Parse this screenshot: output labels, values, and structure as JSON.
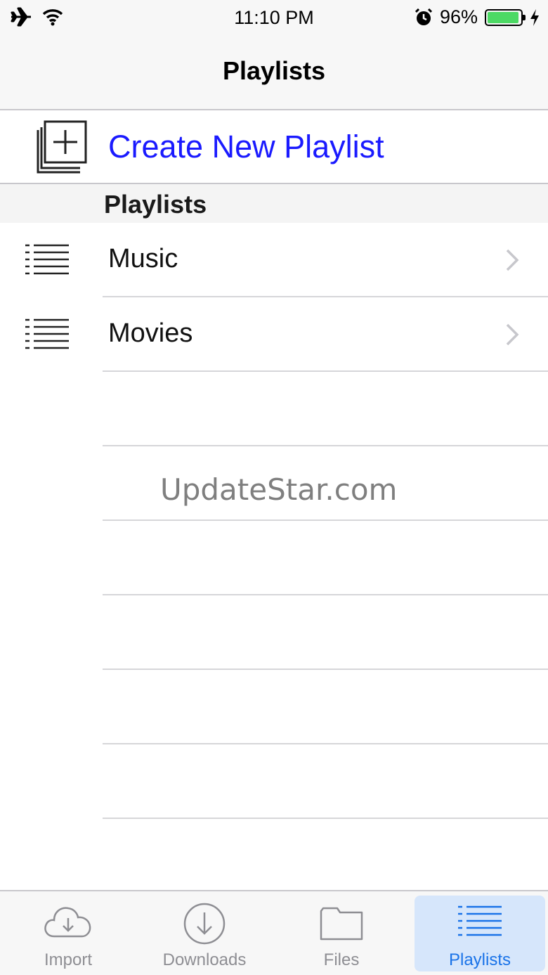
{
  "status_bar": {
    "time": "11:10 PM",
    "battery_percent": "96%",
    "battery_level": 0.96,
    "icons": [
      "airplane-icon",
      "wifi-icon",
      "alarm-icon",
      "battery-icon",
      "charging-bolt-icon"
    ]
  },
  "nav": {
    "title": "Playlists"
  },
  "create": {
    "label": "Create New Playlist",
    "icon": "add-playlist-icon",
    "color": "#1a1aff"
  },
  "section": {
    "title": "Playlists"
  },
  "playlists": [
    {
      "label": "Music",
      "icon": "list-icon"
    },
    {
      "label": "Movies",
      "icon": "list-icon"
    }
  ],
  "watermark": "UpdateStar.com",
  "tabs": [
    {
      "label": "Import",
      "icon": "cloud-download-icon",
      "active": false
    },
    {
      "label": "Downloads",
      "icon": "circle-download-icon",
      "active": false
    },
    {
      "label": "Files",
      "icon": "folder-icon",
      "active": false
    },
    {
      "label": "Playlists",
      "icon": "list-icon",
      "active": true
    }
  ],
  "colors": {
    "accent": "#1a73e8",
    "active_tab_bg": "#d6e6fb",
    "battery_green": "#4cd964"
  }
}
